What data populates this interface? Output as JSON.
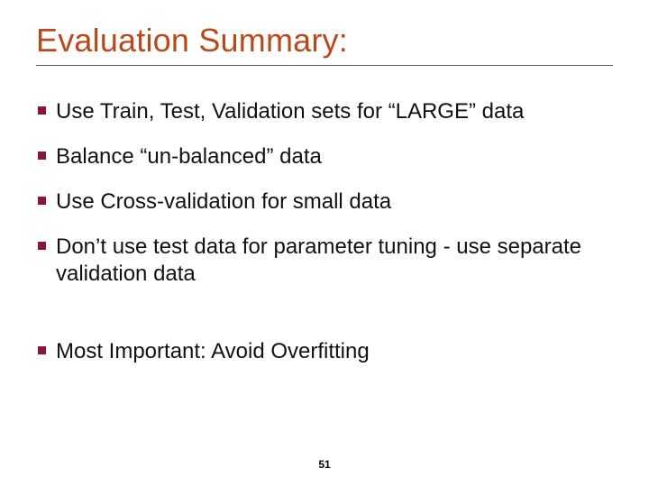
{
  "title": "Evaluation Summary:",
  "bullets": [
    "Use Train, Test, Validation sets for “LARGE” data",
    "Balance “un-balanced” data",
    "Use Cross-validation for small data",
    "Don’t use test data for parameter tuning - use separate validation data"
  ],
  "final_bullet": "Most Important: Avoid Overfitting",
  "page_number": "51"
}
